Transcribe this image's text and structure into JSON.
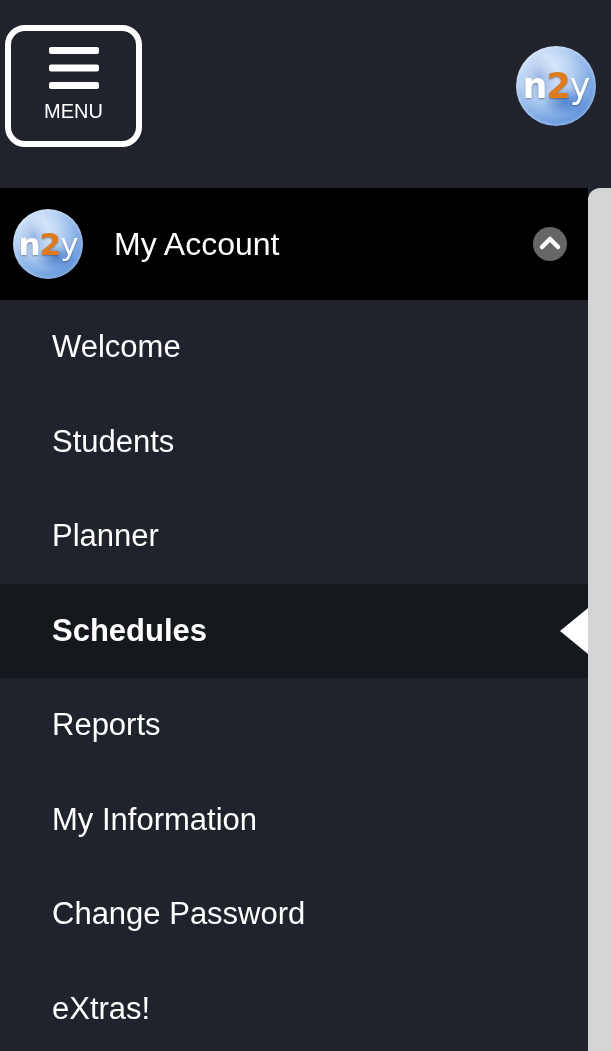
{
  "header": {
    "menu_button": {
      "label": "MENU"
    },
    "logo": {
      "text": "n2y"
    }
  },
  "account": {
    "logo": {
      "text": "n2y"
    },
    "title": "My Account",
    "expanded": true
  },
  "menu_items": [
    {
      "label": "Welcome",
      "selected": false
    },
    {
      "label": "Students",
      "selected": false
    },
    {
      "label": "Planner",
      "selected": false
    },
    {
      "label": "Schedules",
      "selected": true
    },
    {
      "label": "Reports",
      "selected": false
    },
    {
      "label": "My Information",
      "selected": false
    },
    {
      "label": "Change Password",
      "selected": false
    },
    {
      "label": "eXtras!",
      "selected": false
    }
  ]
}
